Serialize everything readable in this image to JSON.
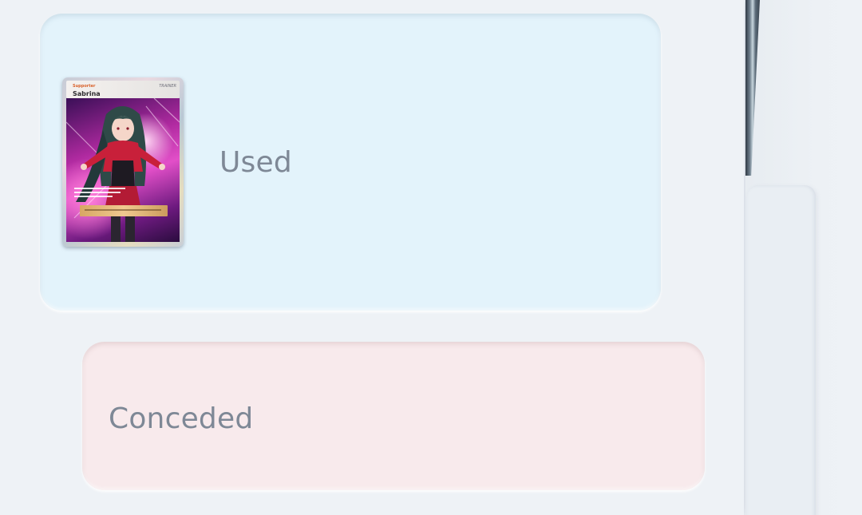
{
  "events": [
    {
      "kind": "used",
      "label": "Used",
      "card": {
        "name": "Sabrina",
        "kind": "Supporter",
        "badge": "TRAINER",
        "icon": "trading-card-image"
      },
      "color": "#e3f3fb"
    },
    {
      "kind": "conceded",
      "label": "Conceded",
      "color": "#f8eaec"
    }
  ],
  "colors": {
    "text": "#7e8896",
    "background": "#eef2f6"
  }
}
